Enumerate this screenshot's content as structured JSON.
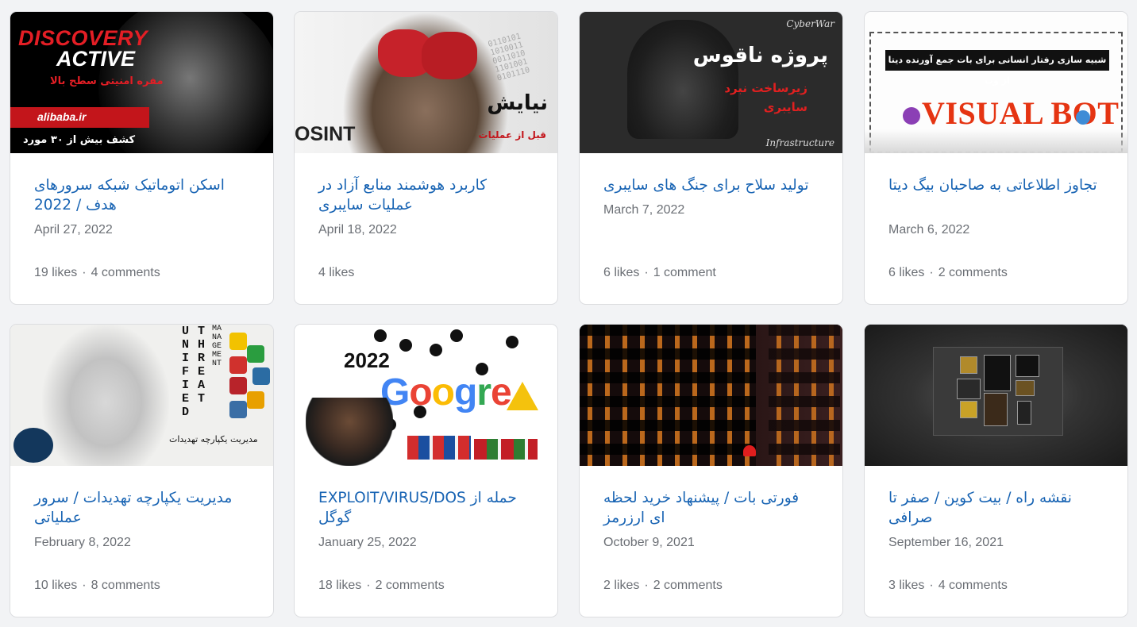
{
  "cards": [
    {
      "title": "اسکن اتوماتیک شبکه سرورهای هدف / 2022",
      "date": "April 27, 2022",
      "likes": "19 likes",
      "comments": "4 comments",
      "thumb": {
        "heading1": "DISCOVERY",
        "heading2": "ACTIVE",
        "sub": "مفره امنیتی سطح بالا",
        "domain": "alibaba.ir",
        "caption": "کشف بیش از ۳۰ مورد"
      }
    },
    {
      "title": "کاربرد هوشمند منابع آزاد در عملیات سایبری",
      "date": "April 18, 2022",
      "likes": "4 likes",
      "comments": "",
      "thumb": {
        "osint": "OSINT",
        "fa1": "نیایش",
        "fa2": "قبل از عملیات"
      }
    },
    {
      "title": "تولید سلاح برای جنگ های سایبری",
      "date": "March 7, 2022",
      "likes": "6 likes",
      "comments": "1 comment",
      "thumb": {
        "top": "CyberWar",
        "fa1": "پروژه ناقوس",
        "fa2a": "زیرساخت نبرد",
        "fa2b": "سایبری",
        "bottom": "Infrastructure"
      }
    },
    {
      "title": "تجاوز اطلاعاتی به صاحبان بیگ دیتا",
      "date": "March 6, 2022",
      "likes": "6 likes",
      "comments": "2 comments",
      "thumb": {
        "bar": "شبیه سازی رفتار انسانی برای بات جمع آورنده دیتا از وب",
        "big": "VISUAL BOT"
      }
    },
    {
      "title": "مدیریت یکپارچه تهدیدات / سرور عملیاتی",
      "date": "February 8, 2022",
      "likes": "10 likes",
      "comments": "8 comments",
      "thumb": {
        "col1": "UNIFIED",
        "col2": "THREAT",
        "col3": "MANAGEMENT",
        "fa": "مدیریت یکپارچه تهدیدات"
      }
    },
    {
      "title": "حمله از EXPLOIT/VIRUS/DOS گوگل",
      "date": "January 25, 2022",
      "likes": "18 likes",
      "comments": "2 comments",
      "thumb": {
        "year": "2022"
      }
    },
    {
      "title": "فورتی بات / پیشنهاد خرید لحظه ای ارزرمز",
      "date": "October 9, 2021",
      "likes": "2 likes",
      "comments": "2 comments",
      "thumb": {}
    },
    {
      "title": "نقشه راه / بیت کوین / صفر تا صرافی",
      "date": "September 16, 2021",
      "likes": "3 likes",
      "comments": "4 comments",
      "thumb": {}
    }
  ],
  "separator": "·",
  "colors": {
    "title": "#1763b3",
    "meta": "#6b6f75",
    "background": "#f2f3f5"
  }
}
